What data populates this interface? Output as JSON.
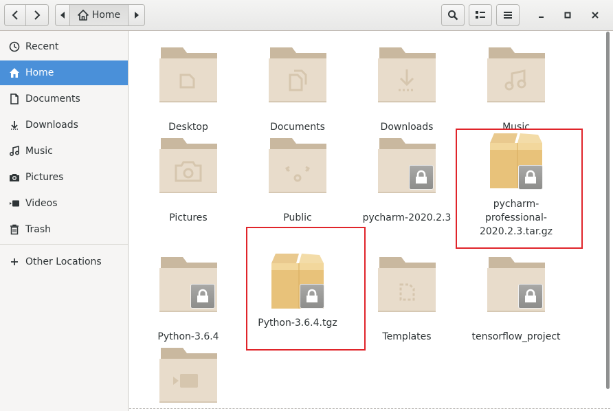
{
  "headerbar": {
    "path_label": "Home",
    "buttons": {
      "back": "back",
      "forward": "forward",
      "path_prev": "path-left",
      "path_next": "path-right",
      "search": "search",
      "view": "view",
      "menu": "menu",
      "minimize": "minimize",
      "maximize": "maximize",
      "close": "close"
    }
  },
  "sidebar": {
    "items": [
      {
        "label": "Recent",
        "icon": "clock-icon"
      },
      {
        "label": "Home",
        "icon": "home-icon",
        "active": true
      },
      {
        "label": "Documents",
        "icon": "document-icon"
      },
      {
        "label": "Downloads",
        "icon": "download-icon"
      },
      {
        "label": "Music",
        "icon": "music-icon"
      },
      {
        "label": "Pictures",
        "icon": "camera-icon"
      },
      {
        "label": "Videos",
        "icon": "video-icon"
      },
      {
        "label": "Trash",
        "icon": "trash-icon"
      }
    ],
    "other_locations": {
      "label": "Other Locations",
      "icon": "plus-icon"
    }
  },
  "files": [
    {
      "name": "Desktop",
      "type": "folder",
      "emblem": "desktop-icon"
    },
    {
      "name": "Documents",
      "type": "folder",
      "emblem": "document-icon"
    },
    {
      "name": "Downloads",
      "type": "folder",
      "emblem": "download-icon"
    },
    {
      "name": "Music",
      "type": "folder",
      "emblem": "music-icon"
    },
    {
      "name": "Pictures",
      "type": "folder",
      "emblem": "camera-icon"
    },
    {
      "name": "Public",
      "type": "folder",
      "emblem": "share-icon"
    },
    {
      "name": "pycharm-2020.2.3",
      "type": "folder",
      "locked": true
    },
    {
      "name_lines": [
        "pycharm-",
        "professional-",
        "2020.2.3.tar.gz"
      ],
      "type": "archive",
      "locked": true,
      "highlighted": true
    },
    {
      "name": "Python-3.6.4",
      "type": "folder",
      "locked": true
    },
    {
      "name": "Python-3.6.4.tgz",
      "type": "archive",
      "locked": true,
      "highlighted": true
    },
    {
      "name": "Templates",
      "type": "folder",
      "emblem": "template-icon"
    },
    {
      "name": "tensorflow_project",
      "type": "folder",
      "locked": true
    },
    {
      "name": "",
      "type": "folder",
      "emblem": "video-icon"
    }
  ],
  "colors": {
    "accent": "#4a90d9",
    "folder_body": "#e8dccb",
    "folder_tab": "#c9b89f",
    "highlight": "#e0242a",
    "lock_badge": "#9a9a98"
  }
}
